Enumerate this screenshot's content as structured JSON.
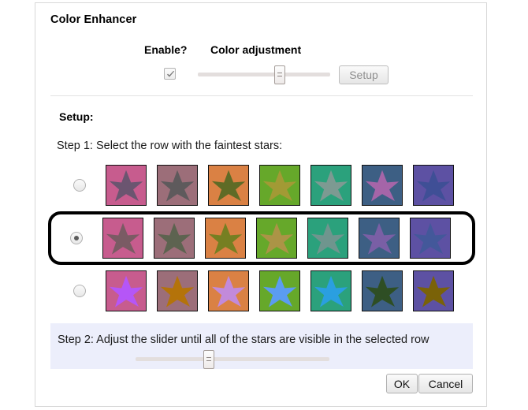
{
  "dialog": {
    "title": "Color Enhancer"
  },
  "top_controls": {
    "enable_label": "Enable?",
    "color_adjustment_label": "Color adjustment",
    "enable_checked": true,
    "slider_value_percent": 62,
    "setup_button_label": "Setup",
    "setup_button_disabled": true
  },
  "setup": {
    "heading": "Setup:",
    "step1_text": "Step 1: Select the row with the faintest stars:",
    "step2_text": "Step 2: Adjust the slider until all of the stars are visible in the selected row",
    "step2_slider_value_percent": 38,
    "selected_row_index": 1,
    "rows": [
      {
        "selected": false,
        "swatches": [
          {
            "bg": "#c75c8e",
            "star": "#6b5570"
          },
          {
            "bg": "#9c6e79",
            "star": "#5e5a5c"
          },
          {
            "bg": "#da8144",
            "star": "#5f6b26"
          },
          {
            "bg": "#66a82a",
            "star": "#a29a35"
          },
          {
            "bg": "#2ba17c",
            "star": "#7d9a92"
          },
          {
            "bg": "#3d5f84",
            "star": "#a565a8"
          },
          {
            "bg": "#5d51a3",
            "star": "#3f4f96"
          }
        ]
      },
      {
        "selected": true,
        "swatches": [
          {
            "bg": "#c75c8e",
            "star": "#7a5b64"
          },
          {
            "bg": "#9c6e79",
            "star": "#5d6350"
          },
          {
            "bg": "#da8144",
            "star": "#767f22"
          },
          {
            "bg": "#66a82a",
            "star": "#ab9446"
          },
          {
            "bg": "#2ba17c",
            "star": "#6f958e"
          },
          {
            "bg": "#3d5f84",
            "star": "#7a5fa5"
          },
          {
            "bg": "#5d51a3",
            "star": "#43589a"
          }
        ]
      },
      {
        "selected": false,
        "swatches": [
          {
            "bg": "#c75c8e",
            "star": "#b556f7"
          },
          {
            "bg": "#9c6e79",
            "star": "#b4730a"
          },
          {
            "bg": "#da8144",
            "star": "#c28ada"
          },
          {
            "bg": "#66a82a",
            "star": "#5b9cf0"
          },
          {
            "bg": "#2ba17c",
            "star": "#2a9fe0"
          },
          {
            "bg": "#3d5f84",
            "star": "#2e4e24"
          },
          {
            "bg": "#5d51a3",
            "star": "#7a6208"
          }
        ]
      }
    ]
  },
  "footer": {
    "ok_label": "OK",
    "cancel_label": "Cancel"
  }
}
